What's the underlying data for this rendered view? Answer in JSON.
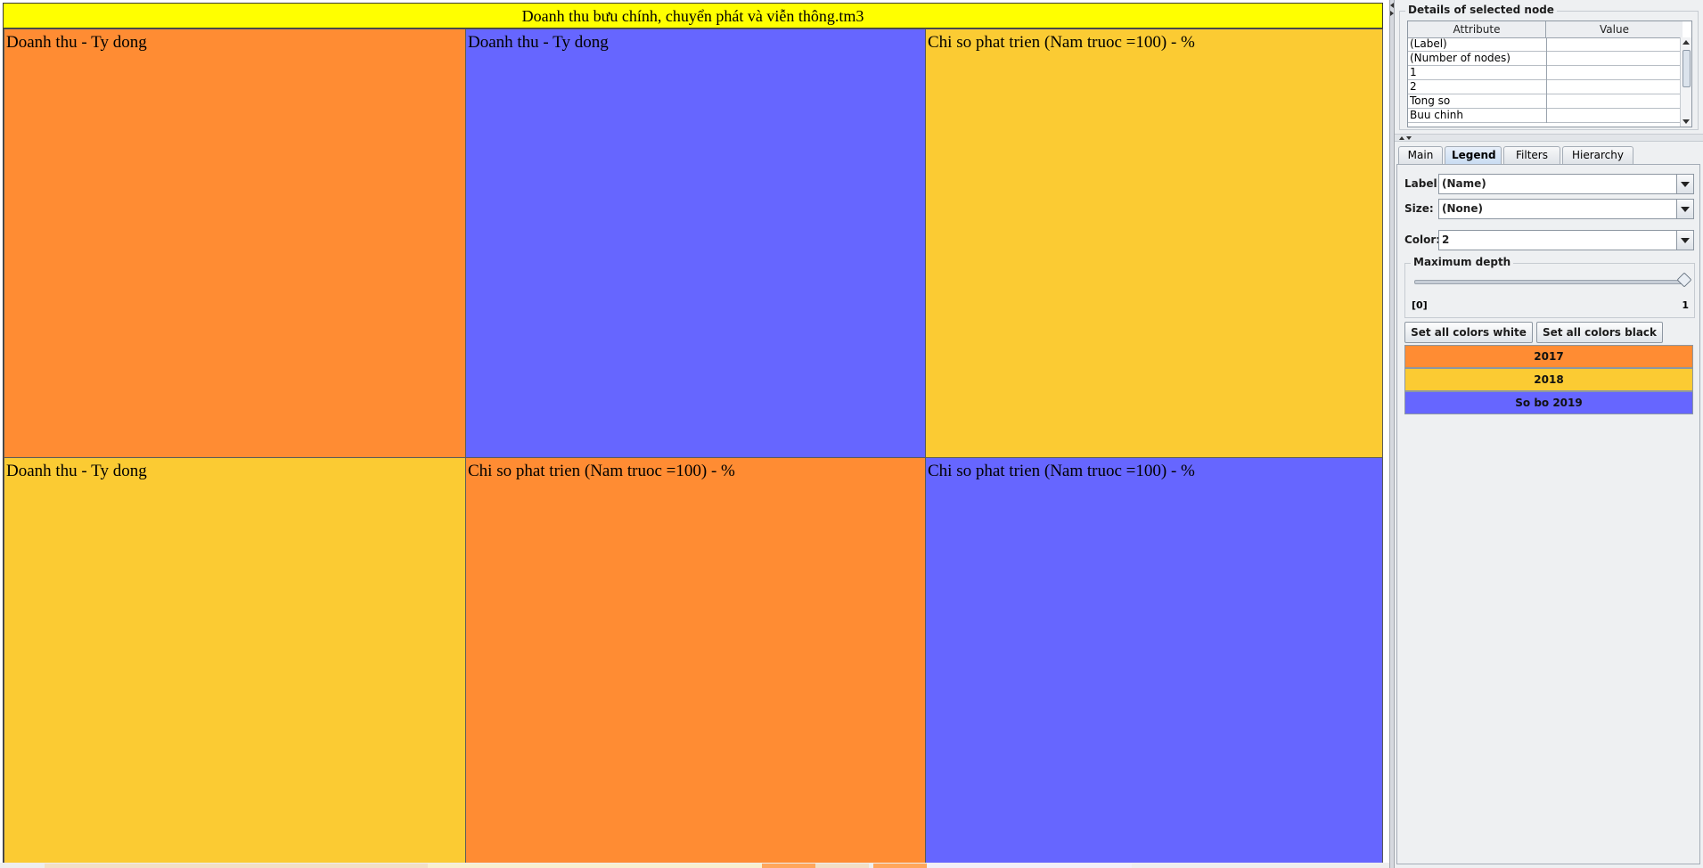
{
  "treemap": {
    "title": "Doanh thu bưu chính, chuyển phát và viễn thông.tm3",
    "cells": [
      {
        "label": "Doanh thu - Ty dong",
        "color": "#ff8c33"
      },
      {
        "label": "Doanh thu - Ty dong",
        "color": "#6666ff"
      },
      {
        "label": "Chi so phat trien (Nam truoc =100) - %",
        "color": "#fbcb33"
      },
      {
        "label": "Doanh thu - Ty dong",
        "color": "#fbcb33"
      },
      {
        "label": "Chi so phat trien (Nam truoc =100) - %",
        "color": "#ff8c33"
      },
      {
        "label": "Chi so phat trien (Nam truoc =100) - %",
        "color": "#6666ff"
      }
    ]
  },
  "details": {
    "title": "Details of selected node",
    "columns": [
      "Attribute",
      "Value"
    ],
    "rows": [
      "(Label)",
      "(Number of nodes)",
      "1",
      "2",
      "Tong so",
      "Buu chinh"
    ]
  },
  "tabs": [
    "Main",
    "Legend",
    "Filters",
    "Hierarchy"
  ],
  "active_tab": "Legend",
  "legend_tab": {
    "label_field": {
      "label": "Label:",
      "value": "(Name)"
    },
    "size_field": {
      "label": "Size:",
      "value": "(None)"
    },
    "color_field": {
      "label": "Color:",
      "value": "2"
    },
    "max_depth": {
      "title": "Maximum depth",
      "min_label": "[0]",
      "max_label": "1",
      "value": 1
    },
    "set_white_label": "Set all colors white",
    "set_black_label": "Set all colors black",
    "legend": [
      {
        "label": "2017",
        "color": "#ff8c33"
      },
      {
        "label": "2018",
        "color": "#fbcb33"
      },
      {
        "label": "So bo 2019",
        "color": "#6666ff"
      }
    ]
  }
}
